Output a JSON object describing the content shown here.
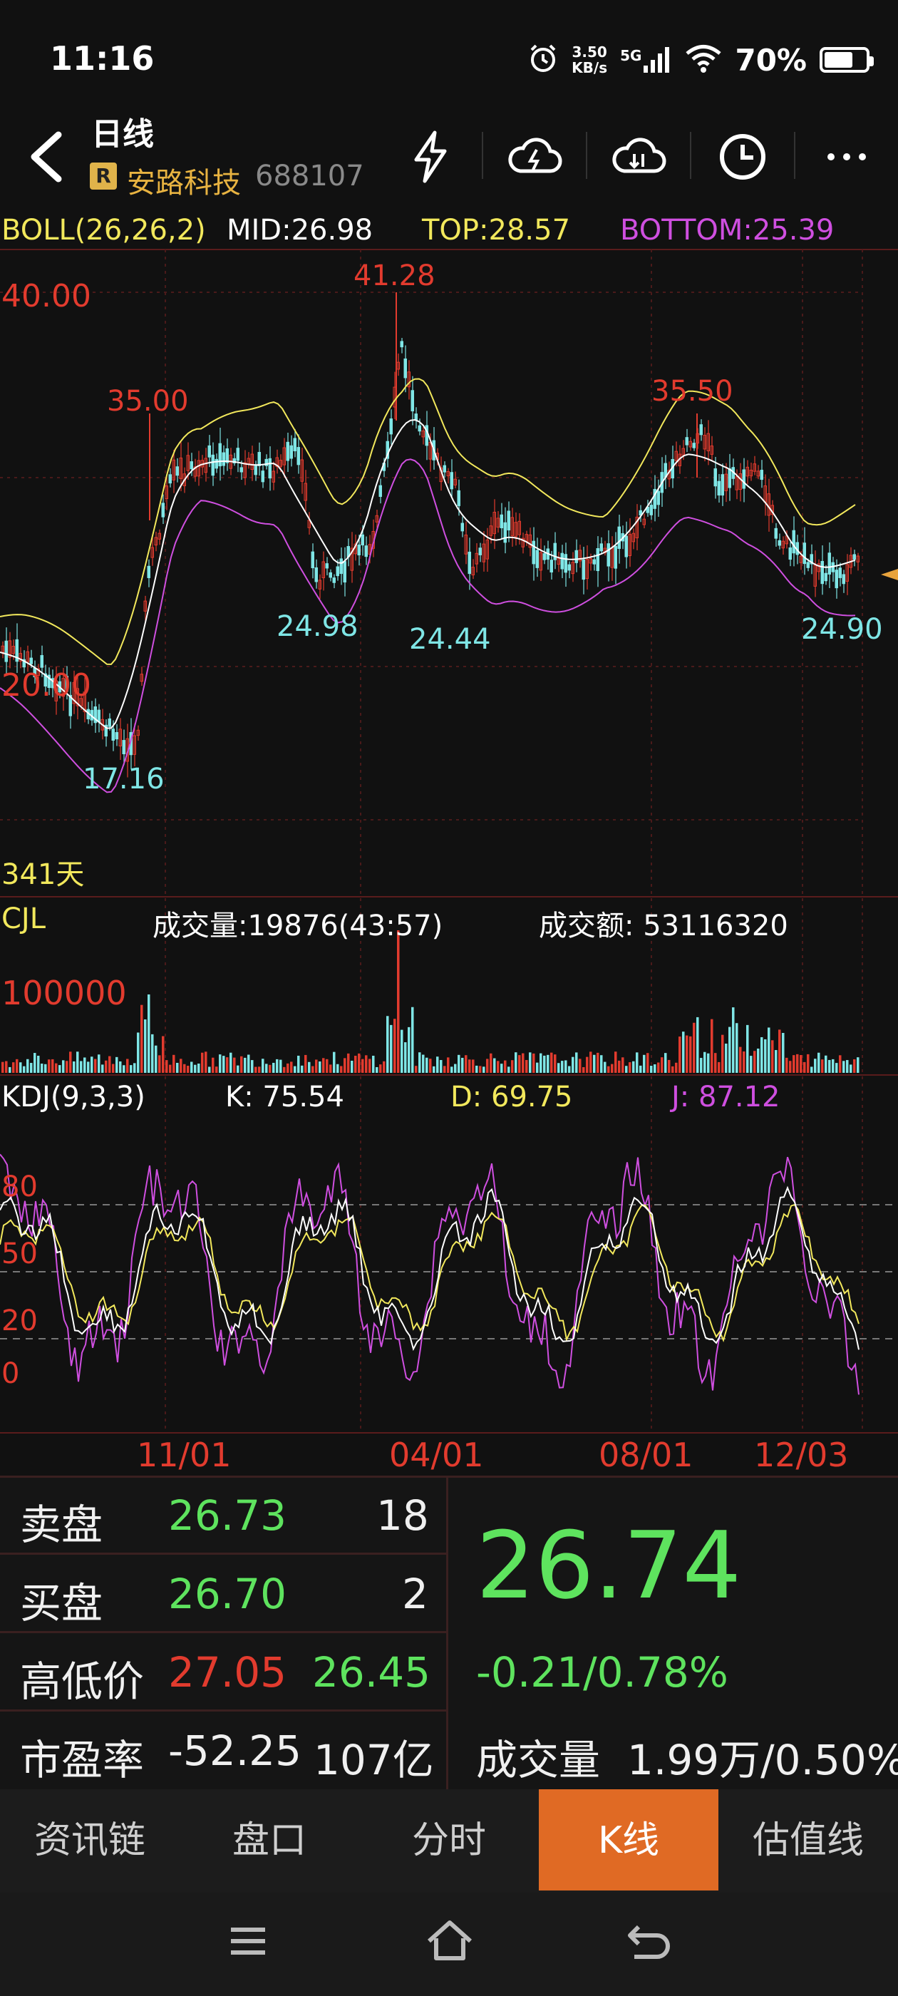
{
  "status": {
    "time": "11:16",
    "net_speed_value": "3.50",
    "net_speed_unit": "KB/s",
    "signal": "5G",
    "battery": "70%",
    "battery_level": 0.7
  },
  "header": {
    "title": "日线",
    "badge": "R",
    "stock_name": "安路科技",
    "stock_code": "688107"
  },
  "boll": {
    "label": "BOLL(26,26,2)",
    "mid": "MID:26.98",
    "top": "TOP:28.57",
    "bottom": "BOTTOM:25.39"
  },
  "price_chart": {
    "levels": [
      "40.00",
      "20.00"
    ],
    "peaks": [
      "41.28",
      "35.00",
      "35.50"
    ],
    "troughs": [
      "17.16",
      "24.98",
      "24.44",
      "24.90"
    ],
    "days": "341天"
  },
  "volume": {
    "label": "CJL",
    "volume_text": "成交量:19876(43:57)",
    "amount_text": "成交额: 53116320",
    "level": "100000"
  },
  "kdj": {
    "label": "KDJ(9,3,3)",
    "k": "K: 75.54",
    "d": "D: 69.75",
    "j": "J: 87.12",
    "levels": [
      "80",
      "50",
      "20",
      "0"
    ]
  },
  "dates": [
    "11/01",
    "04/01",
    "08/01",
    "12/03"
  ],
  "colors": {
    "red": "#e23b2e",
    "green": "#5ee35e",
    "cyan": "#7fe6e6",
    "yellow": "#f2e85c",
    "magenta": "#cf4fe0",
    "orange_tab": "#e06a24",
    "gold": "#e8b341"
  },
  "quote": {
    "sell_label": "卖盘",
    "sell_price": "26.73",
    "sell_qty": "18",
    "buy_label": "买盘",
    "buy_price": "26.70",
    "buy_qty": "2",
    "hilo_label": "高低价",
    "high": "27.05",
    "low": "26.45",
    "pe_label": "市盈率",
    "pe": "-52.25",
    "market_cap": "107亿",
    "last_price": "26.74",
    "change": "-0.21/0.78%",
    "volume_label": "成交量",
    "volume_value": "1.99万/0.50%"
  },
  "tabs": [
    "资讯链",
    "盘口",
    "分时",
    "K线",
    "估值线"
  ],
  "active_tab": "K线",
  "icons": [
    "back-icon",
    "flash-icon",
    "cloud-upload-icon",
    "cloud-download-icon",
    "clock-icon",
    "more-icon",
    "menu-icon",
    "home-icon",
    "back-nav-icon"
  ]
}
